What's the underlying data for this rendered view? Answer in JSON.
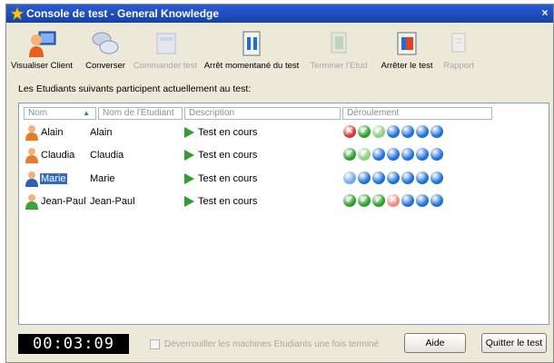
{
  "window": {
    "title": "Console de test - General Knowledge",
    "close_glyph": "×"
  },
  "toolbar": {
    "items": [
      {
        "label": "Visualiser Client",
        "icon": "person-monitor-icon",
        "enabled": true
      },
      {
        "label": "Converser",
        "icon": "chat-bubbles-icon",
        "enabled": true
      },
      {
        "label": "Commander test",
        "icon": "command-test-icon",
        "enabled": false
      },
      {
        "label": "Arrêt momentané du test",
        "icon": "pause-test-icon",
        "enabled": true
      },
      {
        "label": "Terminer l'Etud",
        "icon": "finish-student-icon",
        "enabled": false
      },
      {
        "label": "Arrêter le test",
        "icon": "stop-test-icon",
        "enabled": true
      },
      {
        "label": "Rapport",
        "icon": "report-icon",
        "enabled": false
      }
    ]
  },
  "intro_text": "Les Etudiants suivants participent actuellement au test:",
  "table": {
    "columns": [
      "Nom",
      "Nom de l'Etudiant",
      "Description",
      "Déroulement"
    ],
    "sort_indicator": "▲",
    "rows": [
      {
        "nom": "Alain",
        "student": "Alain",
        "description": "Test en cours",
        "avatar_color": "#e87a2a",
        "selected": false,
        "progress": [
          "wrong",
          "correct",
          "correct-light",
          "pending",
          "pending",
          "pending",
          "pending"
        ]
      },
      {
        "nom": "Claudia",
        "student": "Claudia",
        "description": "Test en cours",
        "avatar_color": "#e87a2a",
        "selected": false,
        "progress": [
          "correct",
          "correct-light",
          "pending",
          "pending",
          "pending",
          "pending",
          "pending"
        ]
      },
      {
        "nom": "Marie",
        "student": "Marie",
        "description": "Test en cours",
        "avatar_color": "#2f5fb5",
        "selected": true,
        "progress": [
          "current",
          "pending",
          "pending",
          "pending",
          "pending",
          "pending",
          "pending"
        ]
      },
      {
        "nom": "Jean-Paul",
        "student": "Jean-Paul",
        "description": "Test en cours",
        "avatar_color": "#3aa33a",
        "selected": false,
        "progress": [
          "correct",
          "correct",
          "correct",
          "wrong-light",
          "pending",
          "pending",
          "pending"
        ]
      }
    ]
  },
  "timer": "00:03:09",
  "checkbox": {
    "label": "Déverrouiller les machines Etudiants une fois terminé",
    "checked": false,
    "enabled": false
  },
  "buttons": {
    "help": "Aide",
    "quit": "Quitter le test"
  },
  "colors": {
    "accent": "#1541a8",
    "pending": "#1f6fd6",
    "correct": "#2aa02a",
    "wrong": "#d8362f"
  }
}
